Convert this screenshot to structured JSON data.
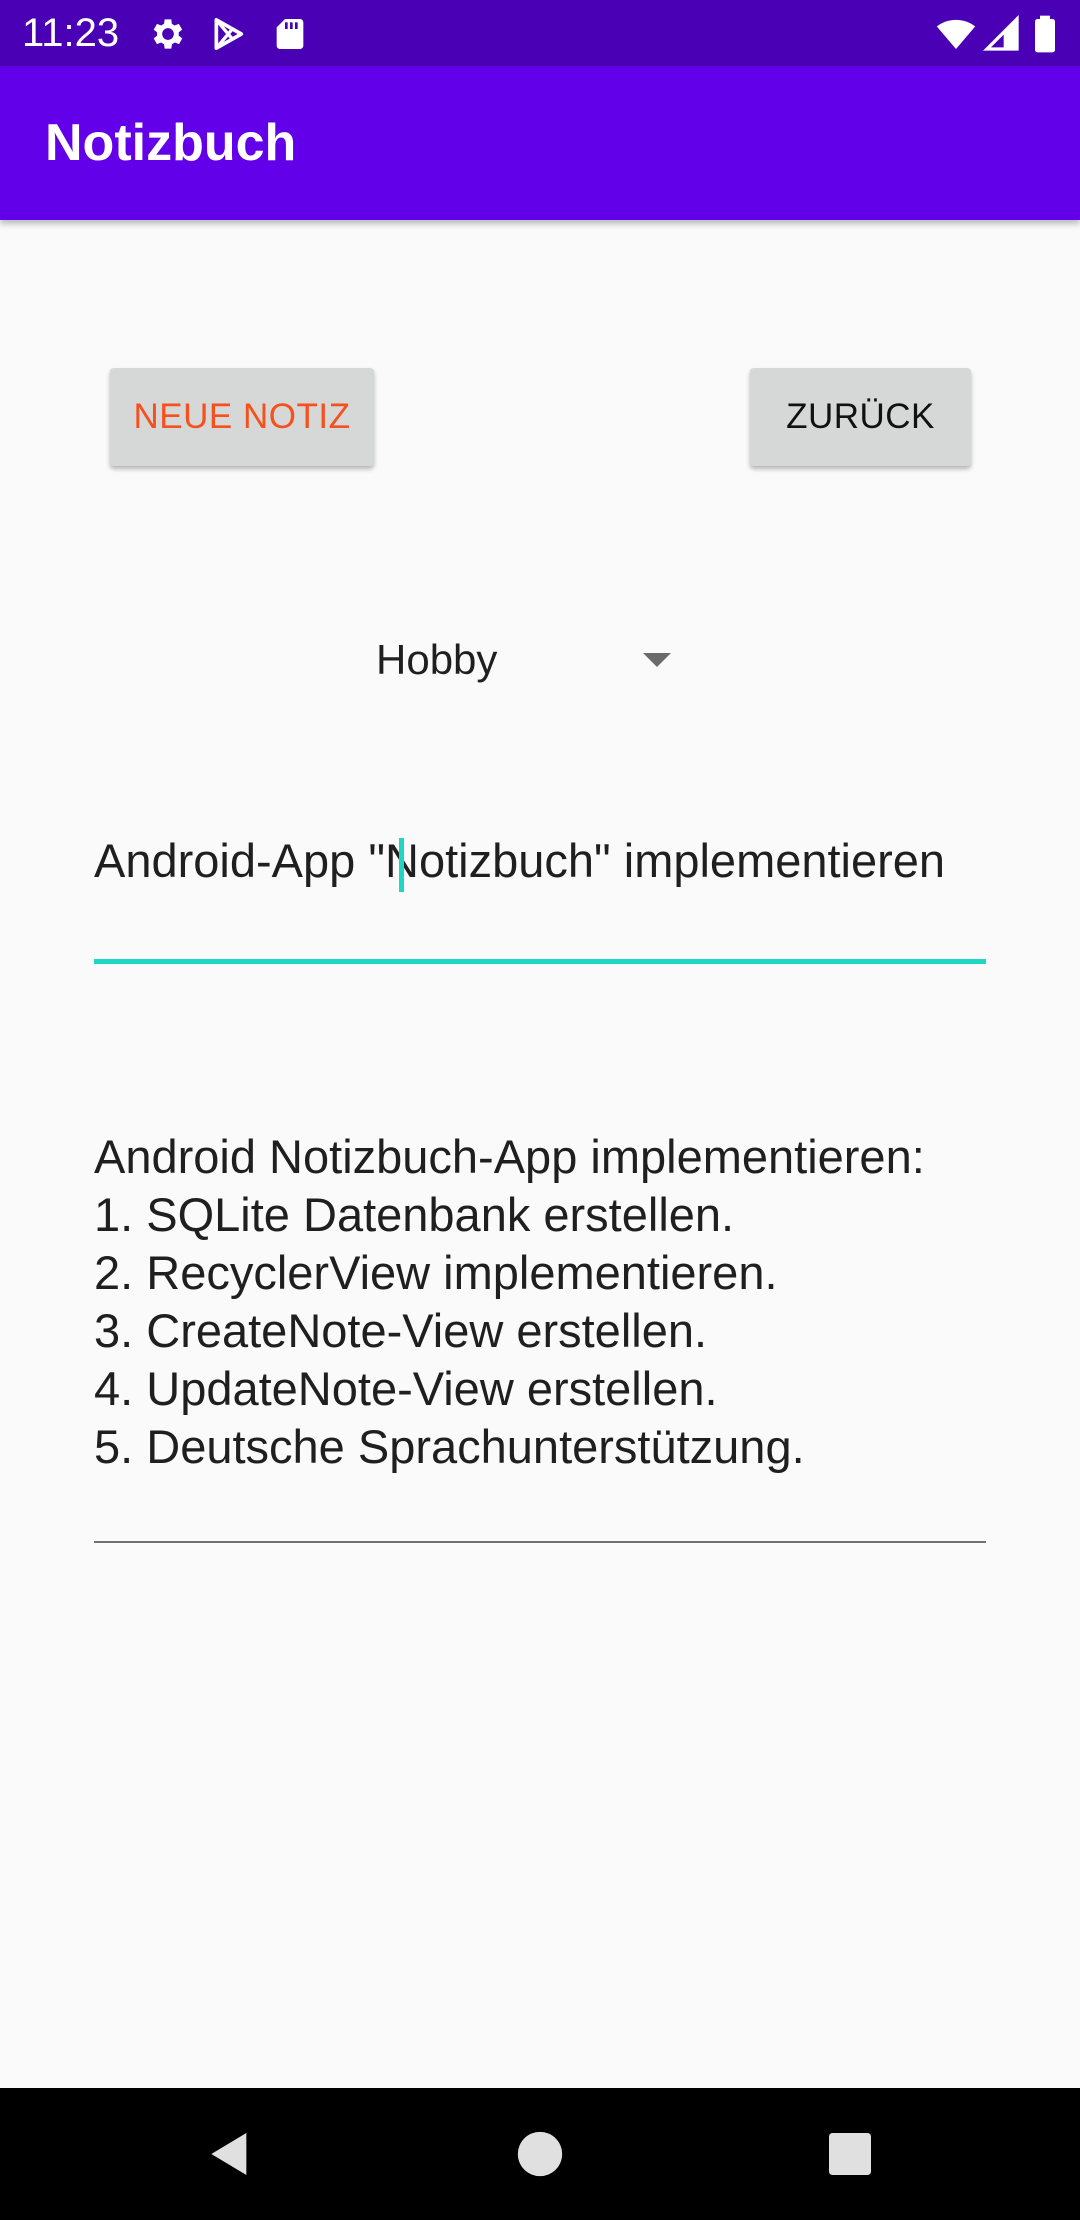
{
  "status_bar": {
    "time": "11:23",
    "icons_left": [
      "gear-icon",
      "play-store-icon",
      "sd-card-icon"
    ],
    "icons_right": [
      "wifi-icon",
      "signal-icon",
      "battery-icon"
    ]
  },
  "app_bar": {
    "title": "Notizbuch"
  },
  "buttons": {
    "new_note_label": "NEUE NOTIZ",
    "back_label": "ZURÜCK"
  },
  "category_spinner": {
    "selected": "Hobby"
  },
  "note": {
    "title": "Android-App \"Notizbuch\" implementieren",
    "body_lines": [
      "Android Notizbuch-App implementieren:",
      "1. SQLite Datenbank erstellen.",
      "2. RecyclerView implementieren.",
      "3. CreateNote-View erstellen.",
      "4. UpdateNote-View erstellen.",
      "5. Deutsche Sprachunterstützung."
    ]
  },
  "nav_bar": {
    "buttons": [
      "back-icon",
      "home-icon",
      "recents-icon"
    ]
  },
  "colors": {
    "status_bar": "#4a00b4",
    "app_bar": "#6200ea",
    "accent": "#1fd6c4",
    "new_note_text": "#f4511e",
    "button_bg": "#d6d7d7"
  }
}
